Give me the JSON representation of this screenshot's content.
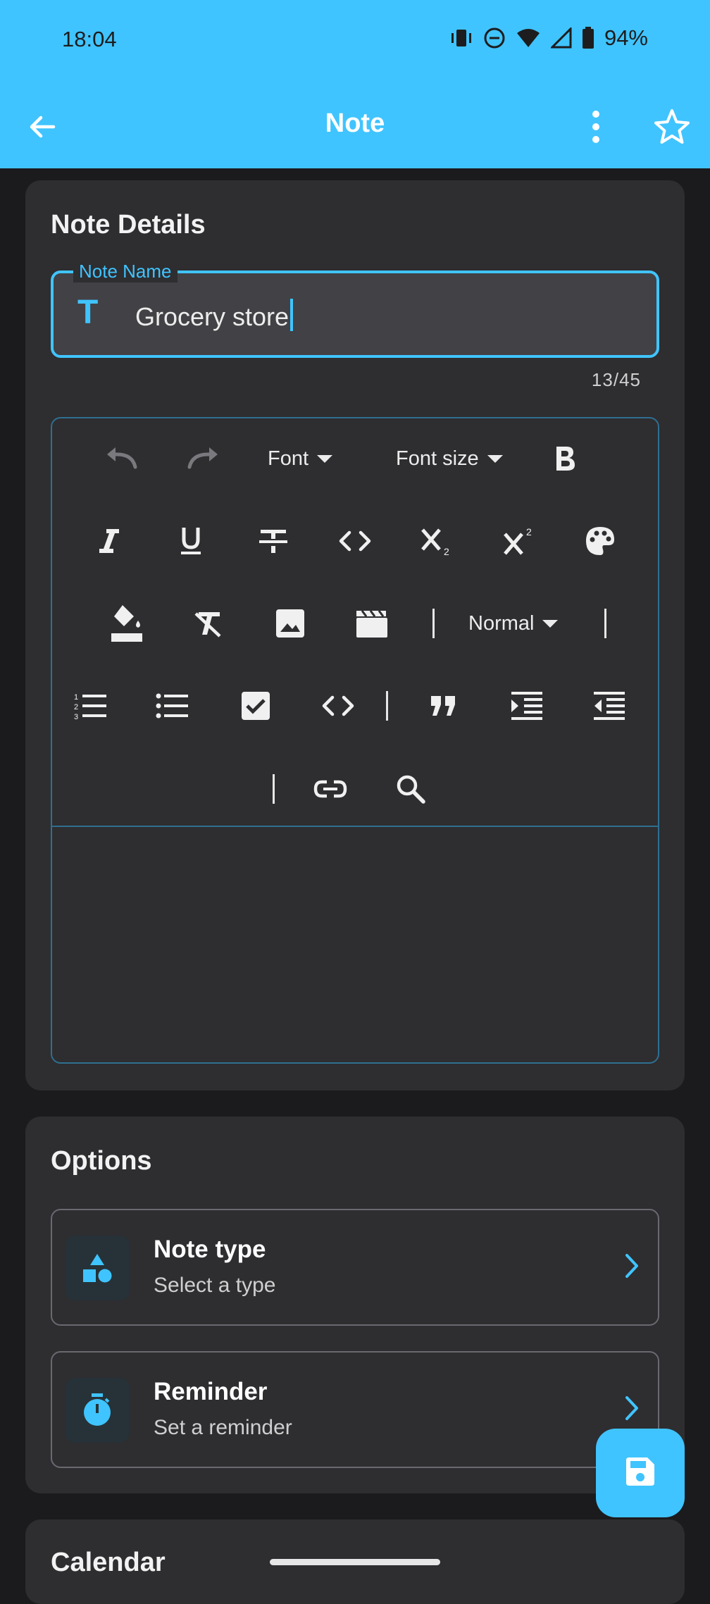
{
  "status_bar": {
    "time": "18:04",
    "battery": "94%"
  },
  "app_bar": {
    "title": "Note",
    "icons": [
      "back-arrow-icon",
      "more-vert-icon",
      "star-outline-icon"
    ]
  },
  "note_details": {
    "title": "Note Details",
    "name_field": {
      "label": "Note Name",
      "value": "Grocery store",
      "counter": "13/45",
      "prefix_icon_text": "T"
    },
    "toolbar": {
      "font_label": "Font",
      "font_size_label": "Font size",
      "heading_label": "Normal"
    }
  },
  "options": {
    "title": "Options",
    "items": [
      {
        "title": "Note type",
        "subtitle": "Select a type",
        "icon": "shapes-icon"
      },
      {
        "title": "Reminder",
        "subtitle": "Set a reminder",
        "icon": "timer-icon"
      }
    ]
  },
  "calendar": {
    "title": "Calendar"
  },
  "colors": {
    "accent": "#40c4ff",
    "card": "#2e2d30",
    "background": "#1b1b1d"
  }
}
